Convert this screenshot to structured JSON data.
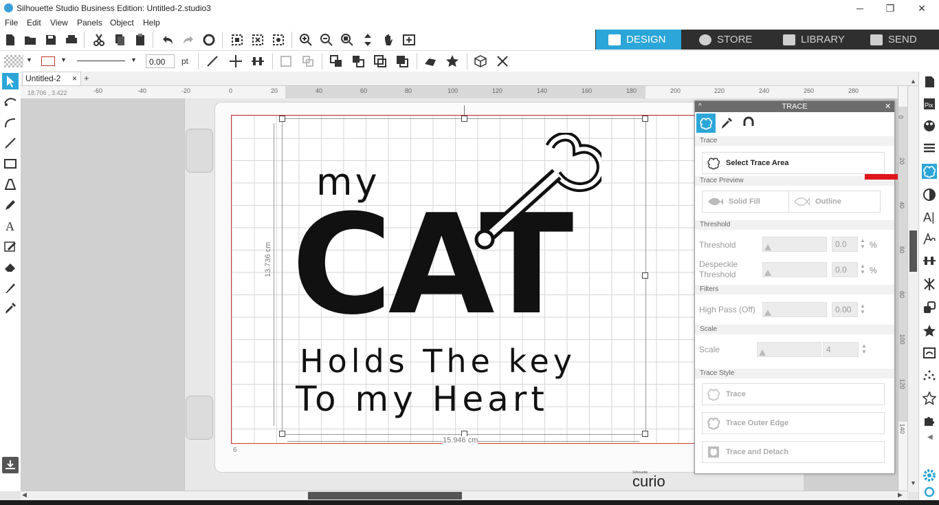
{
  "window": {
    "title": "Silhouette Studio Business Edition: Untitled-2.studio3"
  },
  "menu": [
    "File",
    "Edit",
    "View",
    "Panels",
    "Object",
    "Help"
  ],
  "nav_tabs": [
    {
      "label": "DESIGN",
      "active": true
    },
    {
      "label": "STORE",
      "active": false
    },
    {
      "label": "LIBRARY",
      "active": false
    },
    {
      "label": "SEND",
      "active": false
    }
  ],
  "line_style": {
    "width_value": "0.00",
    "unit": "pt"
  },
  "document": {
    "tab_label": "Untitled-2",
    "close": "×",
    "add": "+"
  },
  "coords": "18.706 , 3.422",
  "ruler_top": [
    "-60",
    "-40",
    "-20",
    "0",
    "20",
    "40",
    "60",
    "80",
    "100",
    "120",
    "140",
    "160",
    "180",
    "200",
    "220",
    "240",
    "260",
    "280"
  ],
  "ruler_right": [
    "0",
    "20",
    "40",
    "60",
    "80",
    "100",
    "120",
    "140"
  ],
  "design": {
    "line1": "my",
    "line2": "CAT",
    "line3": "Holds The key",
    "line4": "To my Heart",
    "height_label": "13.736 cm",
    "width_label": "15.946 cm",
    "page_number": "6"
  },
  "brand": {
    "small": "Silhouette",
    "name": "curio"
  },
  "trace_panel": {
    "title": "TRACE",
    "sections": {
      "trace": "Trace",
      "preview": "Trace Preview",
      "threshold": "Threshold",
      "filters": "Filters",
      "scale": "Scale",
      "style": "Trace Style"
    },
    "select_area": "Select Trace Area",
    "solid_fill": "Solid Fill",
    "outline": "Outline",
    "threshold": {
      "label": "Threshold",
      "value": "0.0",
      "unit": "%"
    },
    "despeckle": {
      "label_line1": "Despeckle",
      "label_line2": "Threshold",
      "value": "0.0",
      "unit": "%"
    },
    "high_pass": {
      "label": "High Pass (Off)",
      "value": "0.00"
    },
    "scale": {
      "label": "Scale",
      "value": "4"
    },
    "buttons": [
      "Trace",
      "Trace Outer Edge",
      "Trace and Detach"
    ]
  },
  "colors": {
    "accent": "#2ca6d8",
    "cut_line": "#d23a3a",
    "arrow": "#e0161b"
  }
}
